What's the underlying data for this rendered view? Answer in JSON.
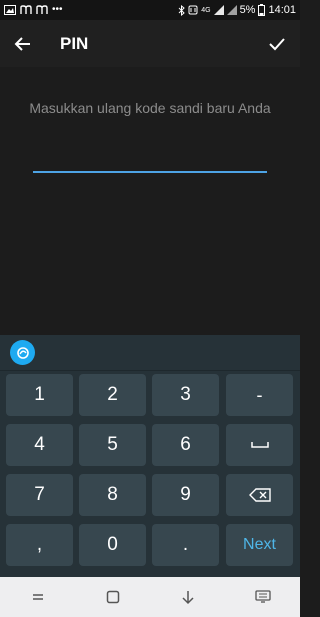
{
  "status_bar": {
    "left_icons": [
      "gallery-icon",
      "m-notification-icon",
      "m-notification-icon",
      "more-notifications-icon"
    ],
    "right_icons": [
      "bluetooth-icon",
      "nfc-icon",
      "4g-icon",
      "signal-icon",
      "signal-icon",
      "battery-icon"
    ],
    "battery": "5%",
    "time": "14:01",
    "network": "4G"
  },
  "app_bar": {
    "title": "PIN"
  },
  "main": {
    "prompt": "Masukkan ulang kode sandi baru Anda",
    "pin_value": ""
  },
  "keyboard": {
    "rows": [
      [
        "1",
        "2",
        "3",
        "-"
      ],
      [
        "4",
        "5",
        "6",
        "␣"
      ],
      [
        "7",
        "8",
        "9",
        "⌫"
      ],
      [
        ",",
        "0",
        ".",
        "Next"
      ]
    ]
  },
  "nav_bar": {
    "buttons": [
      "recents-icon",
      "home-icon",
      "hide-keyboard-icon",
      "keyboard-switch-icon"
    ]
  },
  "colors": {
    "accent": "#4da3e5",
    "key_bg": "#37474f",
    "keyboard_bg": "#263238",
    "app_bg": "#1c1c1c",
    "next_text": "#4fb6e8"
  }
}
